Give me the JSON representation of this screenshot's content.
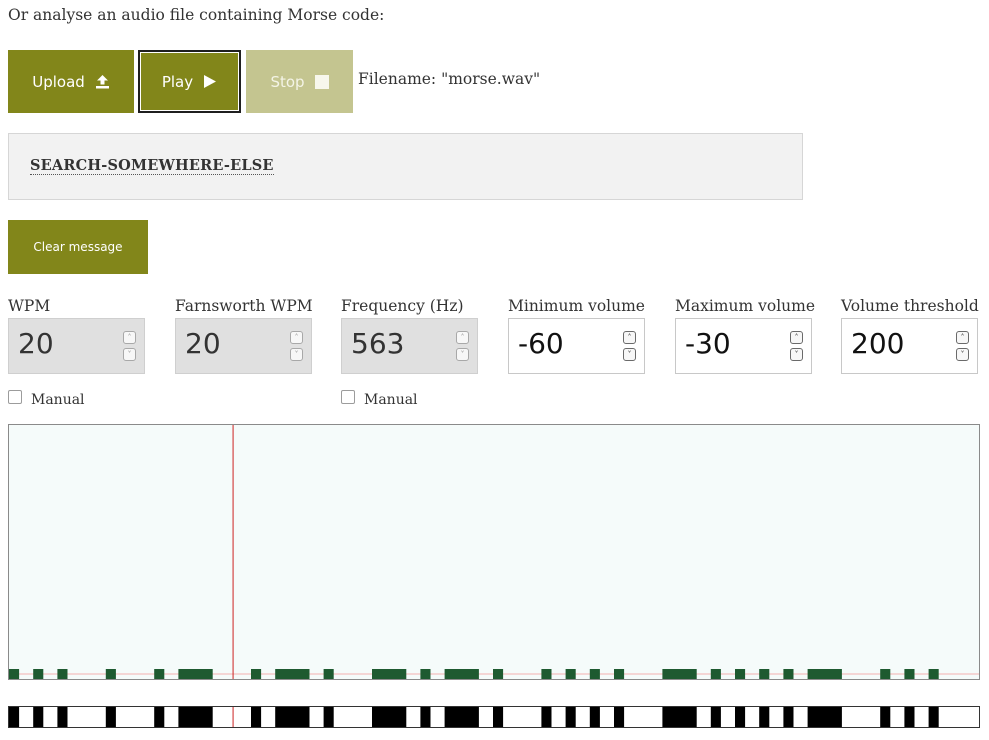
{
  "intro_text": "Or analyse an audio file containing Morse code:",
  "buttons": {
    "upload": {
      "label": "Upload",
      "icon": "upload-icon"
    },
    "play": {
      "label": "Play",
      "icon": "play-icon"
    },
    "stop": {
      "label": "Stop",
      "icon": "stop-icon"
    },
    "clear": {
      "label": "Clear message"
    }
  },
  "filename_text": "Filename: \"morse.wav\"",
  "decoded_message": "SEARCH-SOMEWHERE-ELSE",
  "fields": [
    {
      "label": "WPM",
      "value": "20",
      "disabled": true
    },
    {
      "label": "Farnsworth WPM",
      "value": "20",
      "disabled": true
    },
    {
      "label": "Frequency (Hz)",
      "value": "563",
      "disabled": true
    },
    {
      "label": "Minimum volume",
      "value": "-60",
      "disabled": false
    },
    {
      "label": "Maximum volume",
      "value": "-30",
      "disabled": false
    },
    {
      "label": "Volume threshold",
      "value": "200",
      "disabled": false
    }
  ],
  "manual_wpm": {
    "label": "Manual",
    "checked": false
  },
  "manual_frequency": {
    "label": "Manual",
    "checked": false
  },
  "colors": {
    "accent": "#82861a",
    "accent_disabled": "#c4c590",
    "signal": "#1e5a30",
    "playhead": "#cc2222"
  },
  "playback_position_fraction": 0.231
}
